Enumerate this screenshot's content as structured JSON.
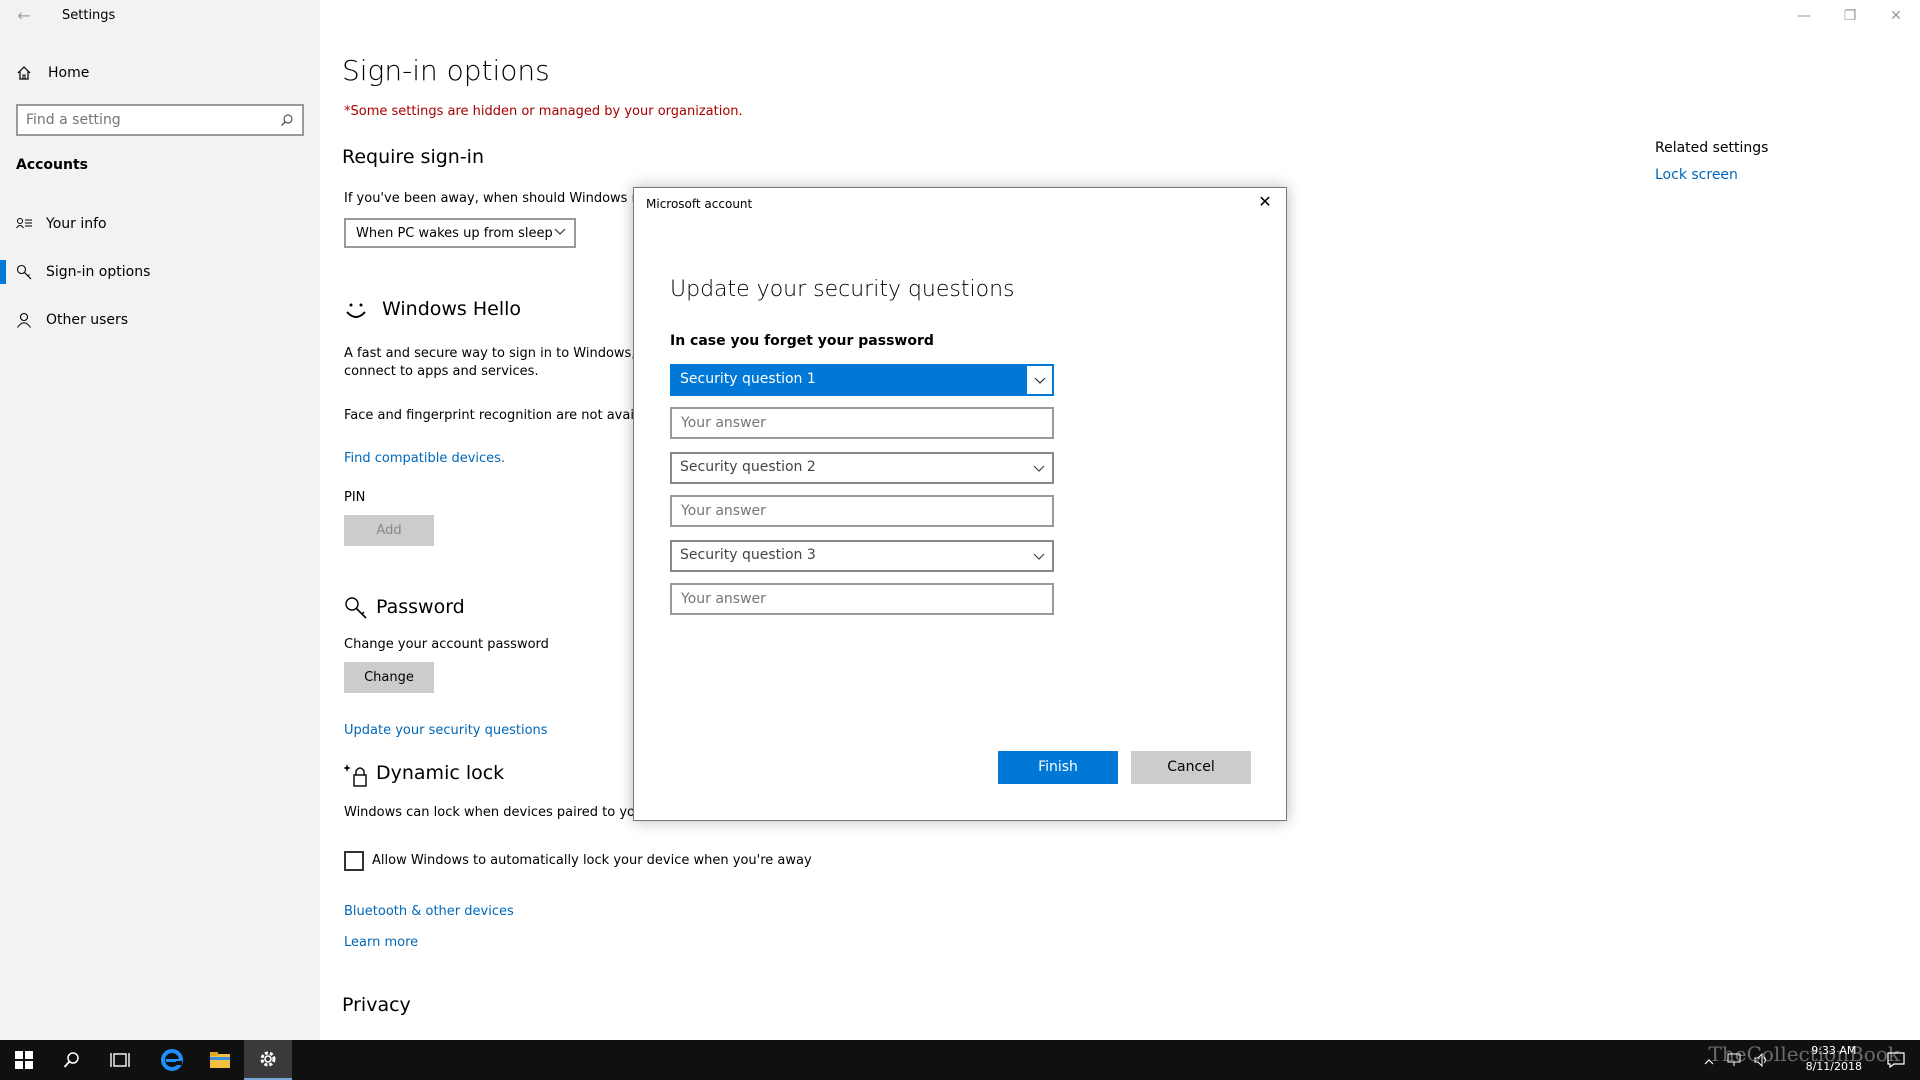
{
  "window": {
    "app_title": "Settings",
    "minimize": "—",
    "maximize": "❐",
    "close": "✕"
  },
  "sidebar": {
    "home_label": "Home",
    "search_placeholder": "Find a setting",
    "section_label": "Accounts",
    "items": [
      {
        "label": "Your info",
        "icon": "person-card-icon"
      },
      {
        "label": "Sign-in options",
        "icon": "key-icon",
        "active": true
      },
      {
        "label": "Other users",
        "icon": "person-icon"
      }
    ]
  },
  "main": {
    "title": "Sign-in options",
    "managed_notice": "*Some settings are hidden or managed by your organization.",
    "require_signin": {
      "heading": "Require sign-in",
      "description": "If you've been away, when should Windows rec",
      "dropdown_value": "When PC wakes up from sleep"
    },
    "windows_hello": {
      "heading": "Windows Hello",
      "description_line1": "A fast and secure way to sign in to Windows, m",
      "description_line2": "connect to apps and services.",
      "availability": "Face and fingerprint recognition are not availab",
      "find_link": "Find compatible devices.",
      "pin_label": "PIN",
      "pin_button": "Add"
    },
    "password": {
      "heading": "Password",
      "description": "Change your account password",
      "button": "Change",
      "security_link": "Update your security questions"
    },
    "dynamic_lock": {
      "heading": "Dynamic lock",
      "description": "Windows can lock when devices paired to your",
      "checkbox_label": "Allow Windows to automatically lock your device when you're away",
      "bluetooth_link": "Bluetooth & other devices",
      "learn_more_link": "Learn more"
    },
    "privacy_heading": "Privacy"
  },
  "related": {
    "title": "Related settings",
    "link": "Lock screen"
  },
  "dialog": {
    "title": "Microsoft account",
    "close": "✕",
    "heading": "Update your security questions",
    "subheading": "In case you forget your password",
    "question1": "Security question 1",
    "question2": "Security question 2",
    "question3": "Security question 3",
    "answer_placeholder": "Your answer",
    "finish": "Finish",
    "cancel": "Cancel"
  },
  "taskbar": {
    "time": "9:33 AM",
    "date": "8/11/2018",
    "watermark": "TheCollectionBook"
  },
  "colors": {
    "accent": "#0078d7",
    "link": "#0067b8",
    "warning": "#a80000",
    "sidebar_bg": "#f2f2f2",
    "taskbar_bg": "#101010"
  }
}
